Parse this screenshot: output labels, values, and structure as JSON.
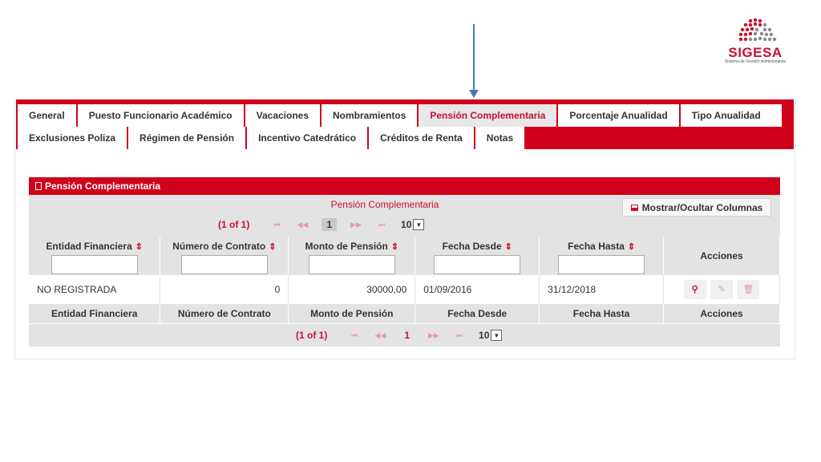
{
  "logo": {
    "name": "SIGESA",
    "subtitle": "Sistema de Gestión Administrativa"
  },
  "tabs_row1": [
    "General",
    "Puesto Funcionario Académico",
    "Vacaciones",
    "Nombramientos",
    "Pensión Complementaria",
    "Porcentaje Anualidad",
    "Tipo Anualidad"
  ],
  "tabs_row2": [
    "Exclusiones Poliza",
    "Régimen de Pensión",
    "Incentivo Catedrático",
    "Créditos de Renta",
    "Notas"
  ],
  "active_tab": "Pensión Complementaria",
  "panel": {
    "title": "Pensión Complementaria",
    "table_title": "Pensión Complementaria",
    "columns_button": "Mostrar/Ocultar Columnas"
  },
  "paginator": {
    "count": "(1 of 1)",
    "first": "⏮",
    "prev": "◀◀",
    "page": "1",
    "next": "▶▶",
    "last": "⏭",
    "rows_per_page": "10",
    "dropdown_arrow": "▼"
  },
  "columns": [
    "Entidad Financiera",
    "Número de Contrato",
    "Monto de Pensión",
    "Fecha Desde",
    "Fecha Hasta",
    "Acciones"
  ],
  "rows": [
    {
      "entidad": "NO REGISTRADA",
      "contrato": "0",
      "monto": "30000,00",
      "desde": "01/09/2016",
      "hasta": "31/12/2018"
    }
  ],
  "actions": {
    "view": "⚲",
    "edit": "✎",
    "delete": "🗑"
  },
  "icons": {
    "sort": "sort-icon",
    "columns": "grid-icon",
    "panel": "document-icon"
  },
  "colors": {
    "brand_red": "#d0021b",
    "header_gray": "#e3e3e3",
    "arrow_blue": "#4a74b8"
  }
}
